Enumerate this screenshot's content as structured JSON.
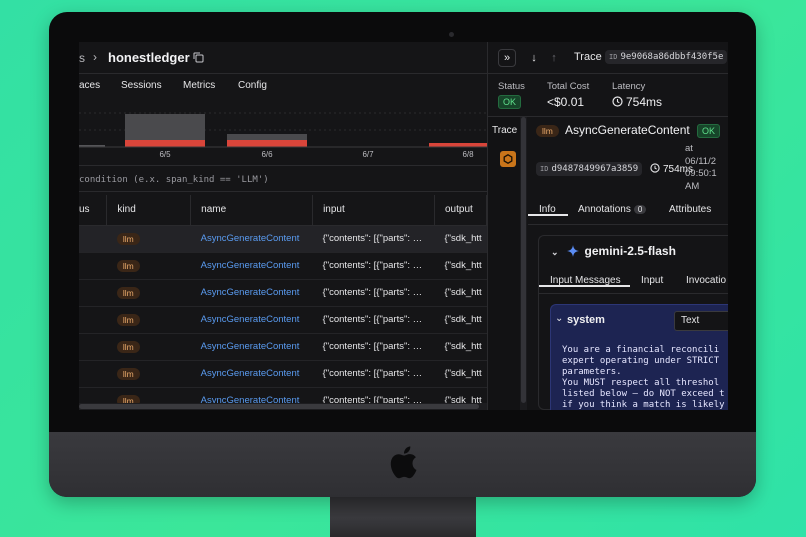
{
  "left": {
    "breadcrumb_prefix": "s",
    "breadcrumb_sep": "›",
    "project_title": "honestledger",
    "tabs": [
      "aces",
      "Sessions",
      "Metrics",
      "Config"
    ],
    "chart_ticks": [
      "6/5",
      "6/6",
      "6/7",
      "6/8"
    ],
    "filter_placeholder": "condition (e.x. span_kind == 'LLM')",
    "table": {
      "headers": [
        "us",
        "kind",
        "name",
        "input",
        "output"
      ],
      "rows": [
        {
          "kind": "llm",
          "name": "AsyncGenerateContent",
          "input": "{\"contents\": [{\"parts\": …",
          "output": "{\"sdk_htt"
        },
        {
          "kind": "llm",
          "name": "AsyncGenerateContent",
          "input": "{\"contents\": [{\"parts\": …",
          "output": "{\"sdk_htt"
        },
        {
          "kind": "llm",
          "name": "AsyncGenerateContent",
          "input": "{\"contents\": [{\"parts\": …",
          "output": "{\"sdk_htt"
        },
        {
          "kind": "llm",
          "name": "AsyncGenerateContent",
          "input": "{\"contents\": [{\"parts\": …",
          "output": "{\"sdk_htt"
        },
        {
          "kind": "llm",
          "name": "AsyncGenerateContent",
          "input": "{\"contents\": [{\"parts\": …",
          "output": "{\"sdk_htt"
        },
        {
          "kind": "llm",
          "name": "AsyncGenerateContent",
          "input": "{\"contents\": [{\"parts\": …",
          "output": "{\"sdk_htt"
        },
        {
          "kind": "llm",
          "name": "AsyncGenerateContent",
          "input": "{\"contents\": [{\"parts\": …",
          "output": "{\"sdk_htt"
        }
      ]
    }
  },
  "right": {
    "header": {
      "trace_label": "Trace",
      "id_tag": "ID",
      "trace_id": "9e9068a86dbbf430f5e"
    },
    "stats": {
      "status_label": "Status",
      "status_value": "OK",
      "cost_label": "Total Cost",
      "cost_value": "<$0.01",
      "latency_label": "Latency",
      "latency_value": "754ms"
    },
    "trace_column_label": "Trace",
    "span": {
      "kind": "llm",
      "title": "AsyncGenerateContent",
      "status": "OK",
      "id_tag": "ID",
      "span_id": "d9487849967a3859",
      "latency": "754ms",
      "at_line1": "at",
      "at_line2": "06/11/2",
      "at_line3": "09:50:1",
      "at_line4": "AM"
    },
    "tabs": {
      "info": "Info",
      "annotations": "Annotations",
      "annotations_count": "0",
      "attributes": "Attributes"
    },
    "model": "gemini-2.5-flash",
    "subtabs": {
      "input_messages": "Input Messages",
      "input": "Input",
      "invocation": "Invocatio"
    },
    "message": {
      "role": "system",
      "format": "Text",
      "body": "You are a financial reconcili\nexpert operating under STRICT\nparameters.\nYou MUST respect all threshol\nlisted below — do NOT exceed t\nif you think a match is likely"
    }
  },
  "colors": {
    "background": "#33e0a4",
    "accent_link": "#5a9bf0",
    "ok_green": "#5fe08c",
    "llm_orange": "#e8a86a",
    "chart_bar_red": "#d9453a",
    "message_bg": "#1d2452"
  },
  "icons": [
    "copy-icon",
    "double-chevron-right-icon",
    "arrow-down-icon",
    "arrow-up-icon",
    "clock-icon",
    "sparkle-icon",
    "chevron-down-icon",
    "hexagon-icon",
    "apple-logo-icon"
  ]
}
